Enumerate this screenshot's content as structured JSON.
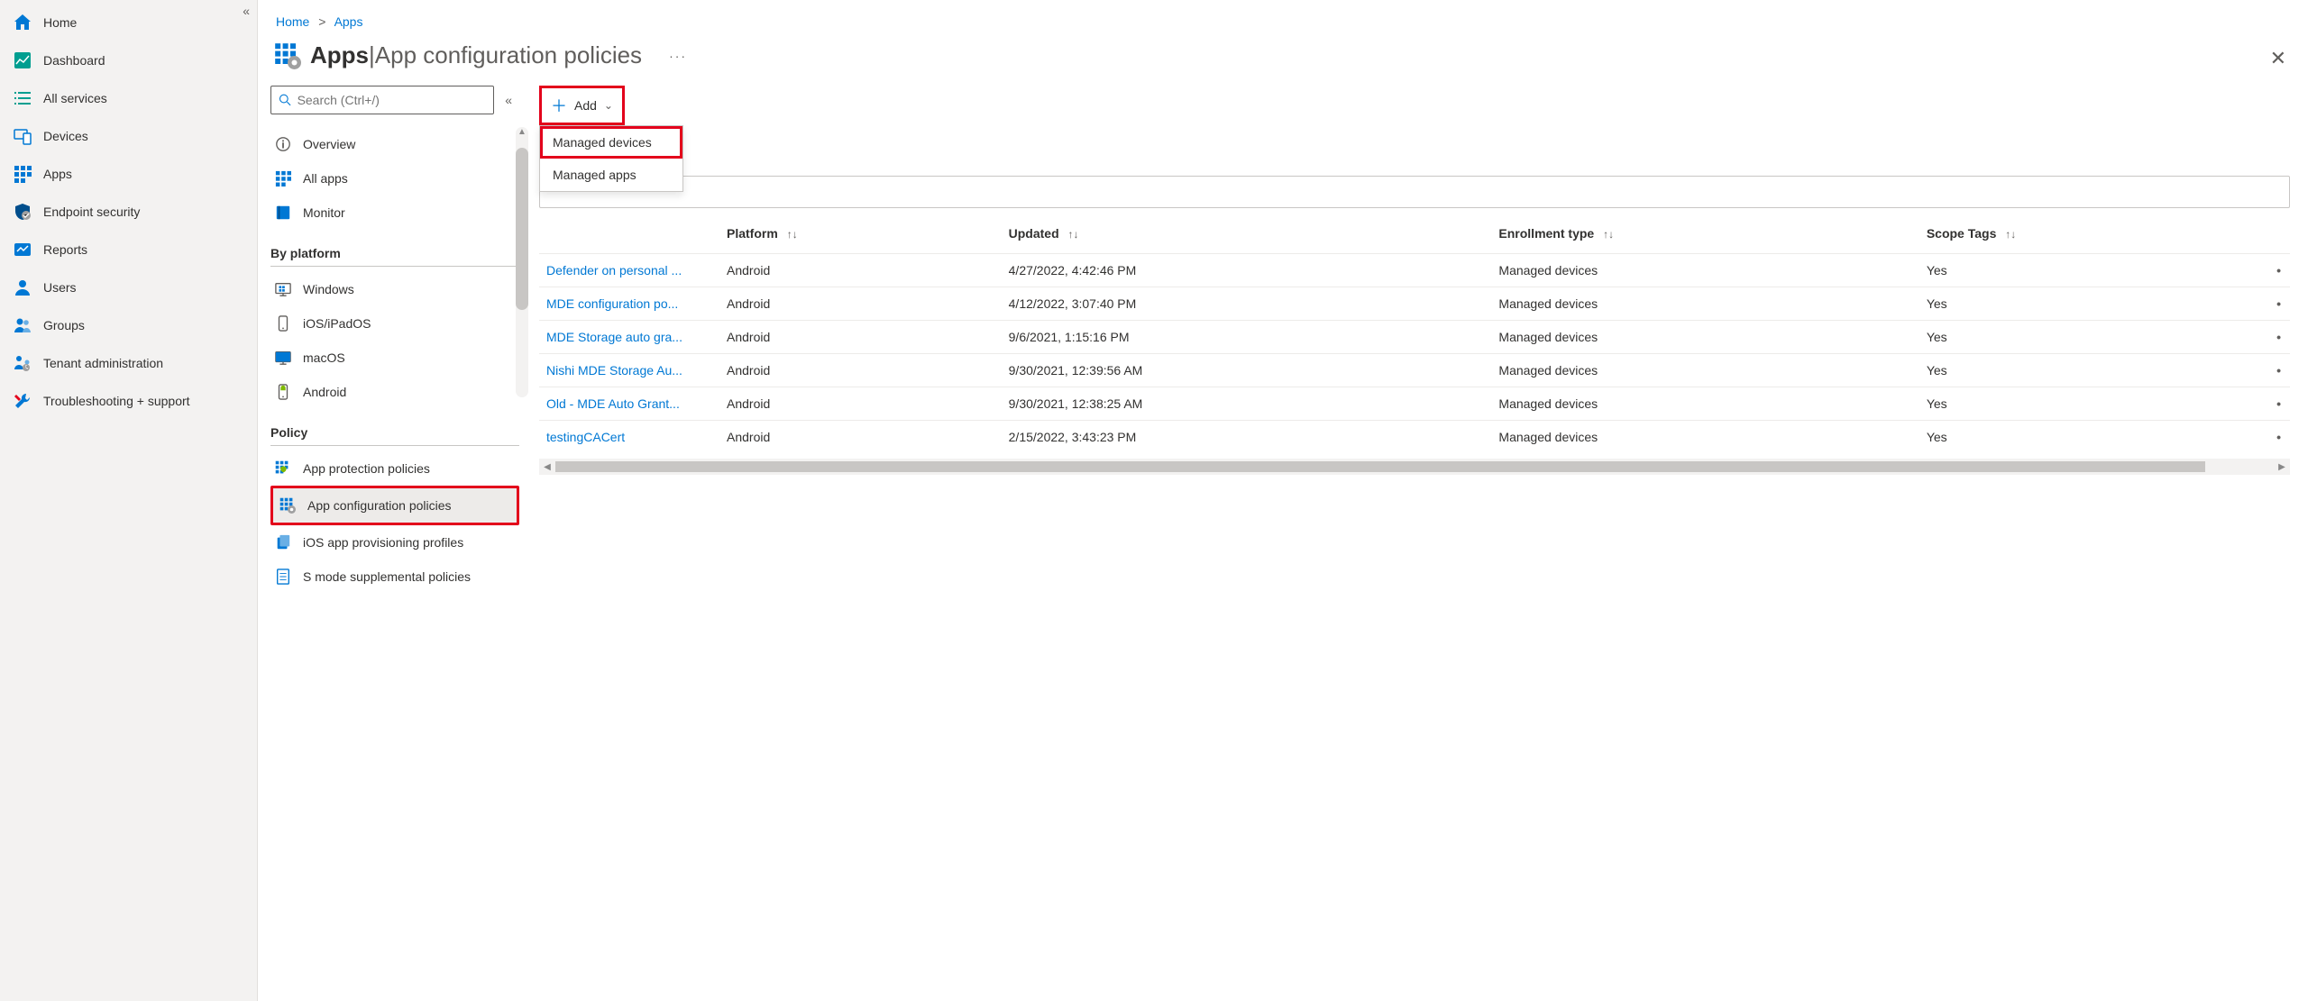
{
  "breadcrumb": {
    "home": "Home",
    "apps": "Apps"
  },
  "header": {
    "title": "Apps",
    "subtitle": "App configuration policies",
    "separator": " | "
  },
  "mainNav": [
    {
      "label": "Home",
      "icon": "home"
    },
    {
      "label": "Dashboard",
      "icon": "dashboard"
    },
    {
      "label": "All services",
      "icon": "list"
    },
    {
      "label": "Devices",
      "icon": "devices"
    },
    {
      "label": "Apps",
      "icon": "apps"
    },
    {
      "label": "Endpoint security",
      "icon": "shield"
    },
    {
      "label": "Reports",
      "icon": "reports"
    },
    {
      "label": "Users",
      "icon": "user"
    },
    {
      "label": "Groups",
      "icon": "group"
    },
    {
      "label": "Tenant administration",
      "icon": "tenant"
    },
    {
      "label": "Troubleshooting + support",
      "icon": "wrench"
    }
  ],
  "search": {
    "placeholder": "Search (Ctrl+/)"
  },
  "subNav": {
    "top": [
      {
        "label": "Overview",
        "icon": "info"
      },
      {
        "label": "All apps",
        "icon": "apps-blue"
      },
      {
        "label": "Monitor",
        "icon": "book"
      }
    ],
    "platformTitle": "By platform",
    "platform": [
      {
        "label": "Windows",
        "icon": "windows"
      },
      {
        "label": "iOS/iPadOS",
        "icon": "ios"
      },
      {
        "label": "macOS",
        "icon": "mac"
      },
      {
        "label": "Android",
        "icon": "android"
      }
    ],
    "policyTitle": "Policy",
    "policy": [
      {
        "label": "App protection policies",
        "icon": "apps-shield"
      },
      {
        "label": "App configuration policies",
        "icon": "apps-gear",
        "selected": true,
        "highlight": true
      },
      {
        "label": "iOS app provisioning profiles",
        "icon": "doc-stack"
      },
      {
        "label": "S mode supplemental policies",
        "icon": "doc-lines"
      }
    ]
  },
  "toolbar": {
    "add": "Add"
  },
  "dropdown": [
    {
      "label": "Managed devices",
      "highlight": true
    },
    {
      "label": "Managed apps"
    }
  ],
  "columns": [
    {
      "label": "Platform",
      "sort": true
    },
    {
      "label": "Updated",
      "sort": true
    },
    {
      "label": "Enrollment type",
      "sort": true
    },
    {
      "label": "Scope Tags",
      "sort": true
    }
  ],
  "rows": [
    {
      "name": "Defender on personal ...",
      "platform": "Android",
      "updated": "4/27/2022, 4:42:46 PM",
      "enroll": "Managed devices",
      "scope": "Yes"
    },
    {
      "name": "MDE configuration po...",
      "platform": "Android",
      "updated": "4/12/2022, 3:07:40 PM",
      "enroll": "Managed devices",
      "scope": "Yes"
    },
    {
      "name": "MDE Storage auto gra...",
      "platform": "Android",
      "updated": "9/6/2021, 1:15:16 PM",
      "enroll": "Managed devices",
      "scope": "Yes"
    },
    {
      "name": "Nishi MDE Storage Au...",
      "platform": "Android",
      "updated": "9/30/2021, 12:39:56 AM",
      "enroll": "Managed devices",
      "scope": "Yes"
    },
    {
      "name": "Old - MDE Auto Grant...",
      "platform": "Android",
      "updated": "9/30/2021, 12:38:25 AM",
      "enroll": "Managed devices",
      "scope": "Yes"
    },
    {
      "name": "testingCACert",
      "platform": "Android",
      "updated": "2/15/2022, 3:43:23 PM",
      "enroll": "Managed devices",
      "scope": "Yes"
    }
  ],
  "icons": {
    "colors": {
      "blue": "#0078d4",
      "teal": "#009e90",
      "shield": "#004e8c"
    }
  }
}
